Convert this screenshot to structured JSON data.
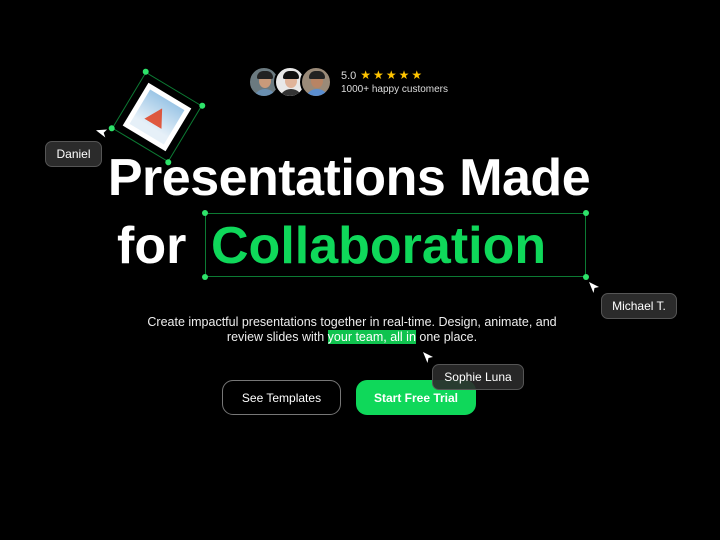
{
  "social_proof": {
    "rating": "5.0",
    "stars": "★★★★★",
    "star_count": 5,
    "customers": "1000+ happy customers",
    "avatars": [
      "avatar-1",
      "avatar-2",
      "avatar-3"
    ]
  },
  "hero": {
    "title_line1": "Presentations Made",
    "title_prefix": "for",
    "title_highlight": "Collaboration",
    "subtitle_line1": "Create impactful presentations together in real-time. Design, animate, and",
    "subtitle_pre": "review slides with",
    "subtitle_highlight": "your team, all in",
    "subtitle_post": "one place."
  },
  "buttons": {
    "secondary": "See Templates",
    "primary": "Start Free Trial"
  },
  "collaborators": [
    {
      "name": "Daniel"
    },
    {
      "name": "Michael T."
    },
    {
      "name": "Sophie Luna"
    }
  ],
  "colors": {
    "accent": "#0fd85a",
    "background": "#000000",
    "star": "#ffc400"
  }
}
